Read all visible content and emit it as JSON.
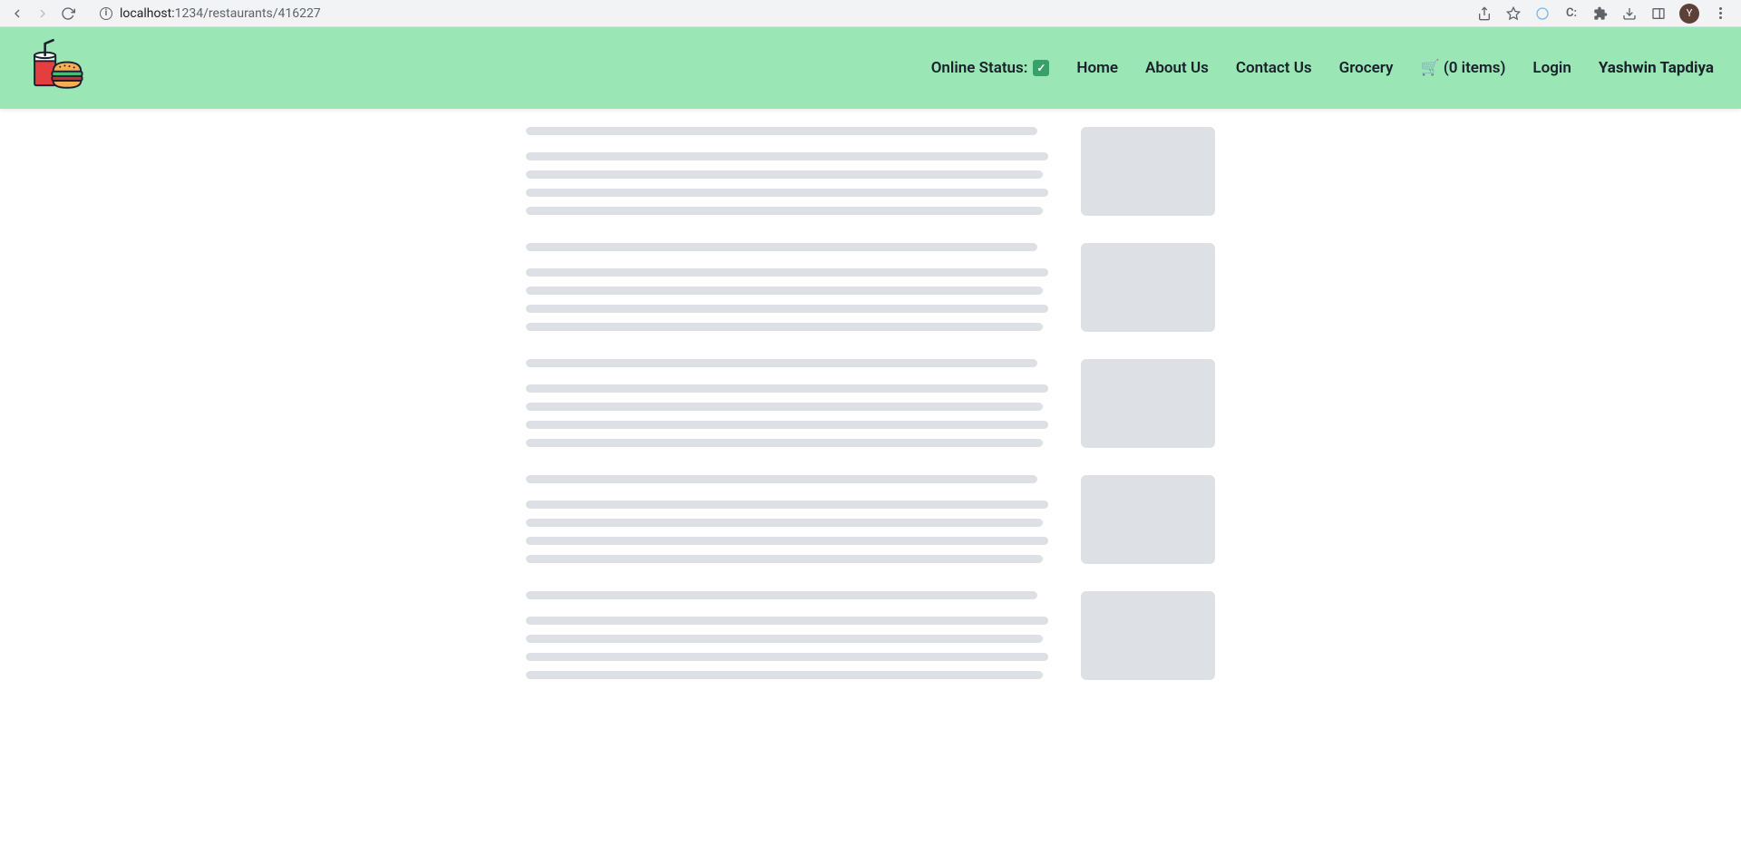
{
  "browser": {
    "url_prefix": "localhost:",
    "url_rest": "1234/restaurants/416227",
    "avatar_initial": "Y"
  },
  "header": {
    "online_status_label": "Online Status:",
    "nav": {
      "home": "Home",
      "about": "About Us",
      "contact": "Contact Us",
      "grocery": "Grocery",
      "cart": "🛒 (0 items)",
      "login": "Login",
      "username": "Yashwin Tapdiya"
    }
  },
  "skeleton": {
    "row_count": 5
  }
}
